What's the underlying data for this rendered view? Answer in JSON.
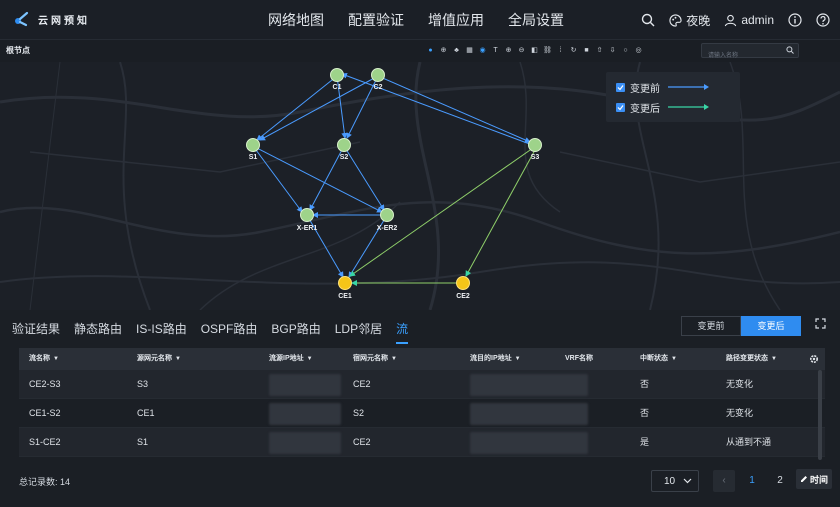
{
  "app": {
    "title": "云网预知"
  },
  "nav": [
    "网络地图",
    "配置验证",
    "增值应用",
    "全局设置"
  ],
  "header": {
    "theme_label": "夜晚",
    "user_name": "admin"
  },
  "toolbar": {
    "root_label": "根节点",
    "search_placeholder": "请输入名称"
  },
  "legend": {
    "before_label": "变更前",
    "after_label": "变更后",
    "before_color": "#4a9bff",
    "after_color": "#39d6a6"
  },
  "topology": {
    "nodes": [
      {
        "id": "C1",
        "label": "C1",
        "status": "normal"
      },
      {
        "id": "C2",
        "label": "C2",
        "status": "normal"
      },
      {
        "id": "S1",
        "label": "S1",
        "status": "normal"
      },
      {
        "id": "S2",
        "label": "S2",
        "status": "normal"
      },
      {
        "id": "S3",
        "label": "S3",
        "status": "normal"
      },
      {
        "id": "XER1",
        "label": "X-ER1",
        "status": "normal"
      },
      {
        "id": "XER2",
        "label": "X-ER2",
        "status": "normal"
      },
      {
        "id": "CE1",
        "label": "CE1",
        "status": "alert"
      },
      {
        "id": "CE2",
        "label": "CE2",
        "status": "alert"
      }
    ],
    "node_colors": {
      "normal": "#9ed38a",
      "alert": "#f5c518"
    }
  },
  "tabs": [
    "验证结果",
    "静态路由",
    "IS-IS路由",
    "OSPF路由",
    "BGP路由",
    "LDP邻居",
    "流"
  ],
  "active_tab": 6,
  "compare": {
    "before": "变更前",
    "after": "变更后"
  },
  "table": {
    "columns": [
      "流名称",
      "源网元名称",
      "流源IP地址",
      "宿网元名称",
      "流目的IP地址",
      "VRF名称",
      "中断状态",
      "路径变更状态"
    ],
    "rows": [
      {
        "name": "CE2-S3",
        "src": "S3",
        "dst": "CE2",
        "interrupt": "否",
        "change": "无变化"
      },
      {
        "name": "CE1-S2",
        "src": "CE1",
        "dst": "S2",
        "interrupt": "否",
        "change": "无变化"
      },
      {
        "name": "S1-CE2",
        "src": "S1",
        "dst": "CE2",
        "interrupt": "是",
        "change": "从通到不通"
      }
    ]
  },
  "footer": {
    "total_label": "总记录数: 14",
    "page_size": "10",
    "pages": [
      "1",
      "2"
    ],
    "time_label": "时间"
  }
}
